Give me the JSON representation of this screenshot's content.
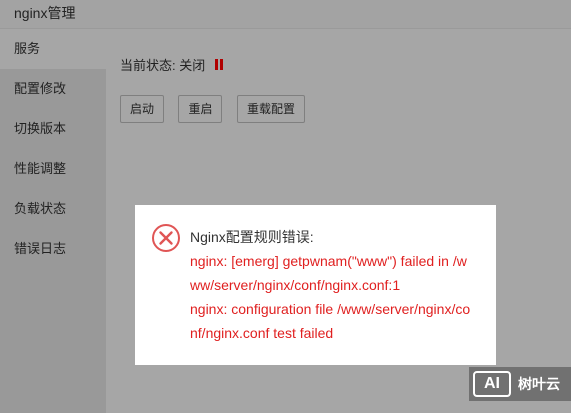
{
  "window": {
    "title": "nginx管理"
  },
  "sidebar": {
    "items": [
      {
        "label": "服务",
        "active": true
      },
      {
        "label": "配置修改"
      },
      {
        "label": "切换版本"
      },
      {
        "label": "性能调整"
      },
      {
        "label": "负载状态"
      },
      {
        "label": "错误日志"
      }
    ]
  },
  "status": {
    "label": "当前状态:",
    "value": "关闭",
    "icon": "pause-icon",
    "icon_color": "#b00000"
  },
  "actions": {
    "start": "启动",
    "restart": "重启",
    "reload": "重载配置"
  },
  "dialog": {
    "icon": "error-circle-icon",
    "icon_color": "#e05555",
    "title": "Nginx配置规则错误:",
    "lines": [
      "nginx: [emerg] getpwnam(\"www\") failed in /www/server/nginx/conf/nginx.conf:1",
      "nginx: configuration file /www/server/nginx/conf/nginx.conf test failed"
    ],
    "text_color": "#e02020"
  },
  "watermark": {
    "logo": "AI",
    "text": "树叶云"
  }
}
